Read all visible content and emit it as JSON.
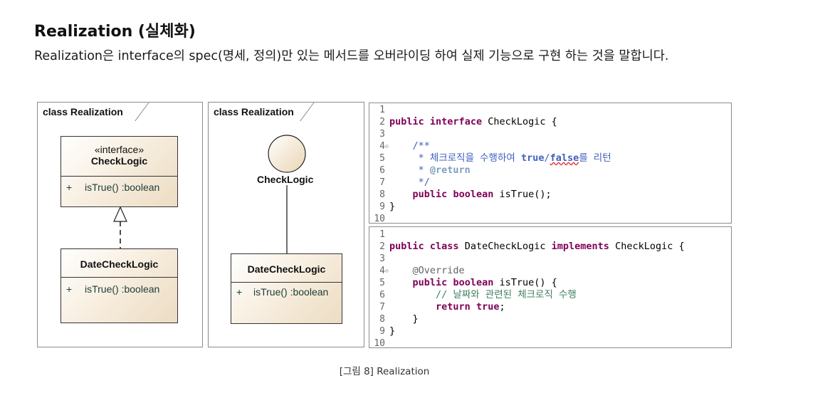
{
  "section": {
    "title": "Realization (실체화)",
    "description": "Realization은 interface의 spec(명세, 정의)만 있는 메서드를 오버라이딩 하여 실제 기능으로 구현 하는 것을 말합니다."
  },
  "diagram_left": {
    "frame_label": "class Realization",
    "interface_box": {
      "stereotype": "«interface»",
      "name": "CheckLogic",
      "operation_visibility": "+",
      "operation": "isTrue() :boolean"
    },
    "impl_box": {
      "name": "DateCheckLogic",
      "operation_visibility": "+",
      "operation": "isTrue() :boolean"
    }
  },
  "diagram_right": {
    "frame_label": "class Realization",
    "interface_label": "CheckLogic",
    "impl_box": {
      "name": "DateCheckLogic",
      "operation_visibility": "+",
      "operation": "isTrue() :boolean"
    }
  },
  "code_interface": {
    "line_numbers": [
      "1",
      "2",
      "3",
      "4",
      "5",
      "6",
      "7",
      "8",
      "9",
      "10"
    ],
    "line2": {
      "kw1": "public",
      "kw2": "interface",
      "rest": "CheckLogic {"
    },
    "line4": "/**",
    "line5_a": " * 체크로직을 수행하여 ",
    "line5_b": "true",
    "line5_c": "/",
    "line5_d": "false",
    "line5_e": "를 리턴",
    "line6_a": " * ",
    "line6_b": "@return",
    "line7": " */",
    "line8": {
      "kw1": "public",
      "kw2": "boolean",
      "rest": "isTrue();"
    },
    "line9": "}"
  },
  "code_impl": {
    "line_numbers": [
      "1",
      "2",
      "3",
      "4",
      "5",
      "6",
      "7",
      "8",
      "9",
      "10"
    ],
    "line2": {
      "kw1": "public",
      "kw2": "class",
      "name": "DateCheckLogic",
      "kw3": "implements",
      "rest": "CheckLogic {"
    },
    "line4": "@Override",
    "line5": {
      "kw1": "public",
      "kw2": "boolean",
      "rest": "isTrue() {"
    },
    "line6": "// 날짜와 관련된 체크로직 수행",
    "line7": {
      "kw1": "return",
      "kw2": "true",
      "rest": ";"
    },
    "line8": "}",
    "line9": "}"
  },
  "caption": "[그림 8] Realization"
}
